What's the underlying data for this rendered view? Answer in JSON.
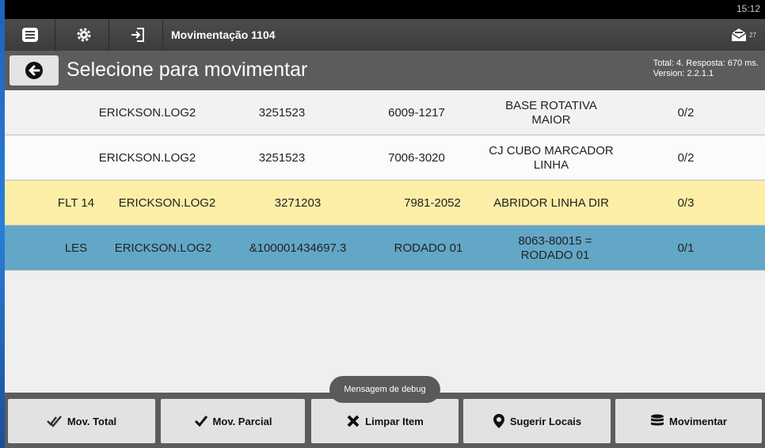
{
  "status_bar": {
    "time": "15:12"
  },
  "action_bar": {
    "title": "Movimentação 1104",
    "mail_count": "27"
  },
  "header": {
    "title": "Selecione para movimentar",
    "info_line1": "Total: 4. Resposta: 670 ms.",
    "info_line2": "Version: 2.2.1.1"
  },
  "rows": [
    {
      "col0": "",
      "col1": "ERICKSON.LOG2",
      "col2": "3251523",
      "col3": "6009-1217",
      "col4": "BASE ROTATIVA MAIOR",
      "col5": "0/2",
      "bg": "#f2f2f2"
    },
    {
      "col0": "",
      "col1": "ERICKSON.LOG2",
      "col2": "3251523",
      "col3": "7006-3020",
      "col4": "CJ CUBO MARCADOR LINHA",
      "col5": "0/2",
      "bg": "#fbfbfb"
    },
    {
      "col0": "FLT 14",
      "col1": "ERICKSON.LOG2",
      "col2": "3271203",
      "col3": "7981-2052",
      "col4": "ABRIDOR LINHA DIR",
      "col5": "0/3",
      "bg": "#fdeea7"
    },
    {
      "col0": "LES",
      "col1": "ERICKSON.LOG2",
      "col2": "&100001434697.3",
      "col3": "RODADO 01",
      "col4": "8063-80015 = RODADO 01",
      "col5": "0/1",
      "bg": "#63a7c7"
    }
  ],
  "toast": "Mensagem de debug",
  "buttons": {
    "mov_total": "Mov. Total",
    "mov_parcial": "Mov. Parcial",
    "limpar_item": "Limpar Item",
    "sugerir_locais": "Sugerir Locais",
    "movimentar": "Movimentar"
  },
  "icons": {
    "menu": "list-icon",
    "settings": "gear-icon",
    "login": "enter-icon",
    "mail": "mail-icon",
    "back": "back-arrow-icon",
    "mov_total": "double-check-icon",
    "mov_parcial": "check-icon",
    "limpar": "x-icon",
    "sugerir": "map-pin-icon",
    "movimentar": "database-icon"
  }
}
